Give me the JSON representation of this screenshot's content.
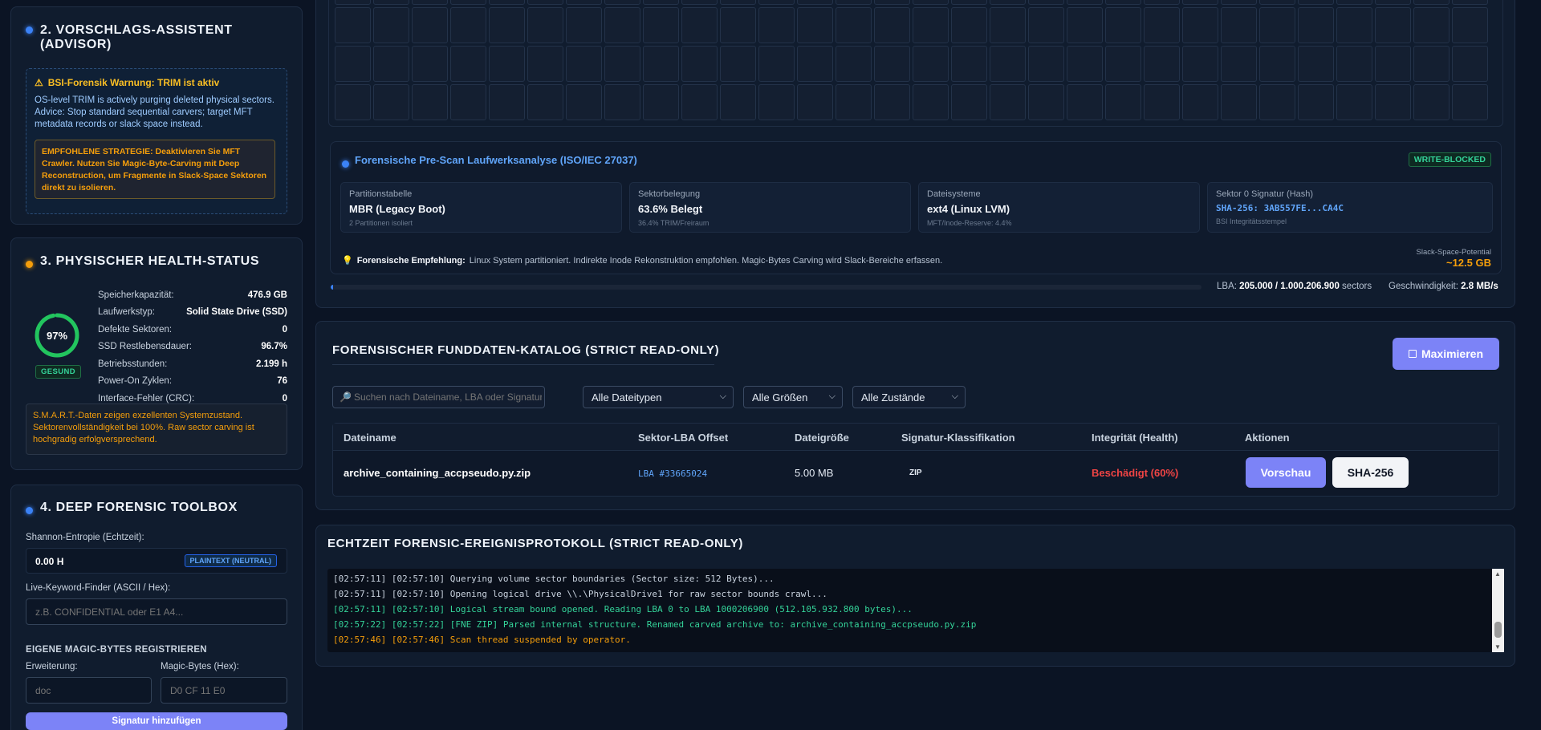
{
  "colors": {
    "background": "#0b1424",
    "panel": "#101c2e",
    "accent": "#7c83f7",
    "warning": "#f59e0b",
    "ok": "#22c55e",
    "danger": "#ef4444",
    "link": "#60a5fa"
  },
  "advisor": {
    "title": "2. VORSCHLAGS-ASSISTENT (ADVISOR)",
    "warning_title": "BSI-Forensik Warnung: TRIM ist aktiv",
    "warning_text": "OS-level TRIM is actively purging deleted physical sectors. Advice: Stop standard sequential carvers; target MFT metadata records or slack space instead.",
    "strategy_text": "EMPFOHLENE STRATEGIE: Deaktivieren Sie MFT Crawler. Nutzen Sie Magic-Byte-Carving mit Deep Reconstruction, um Fragmente in Slack-Space Sektoren direkt zu isolieren."
  },
  "health": {
    "title": "3. PHYSISCHER HEALTH-STATUS",
    "gauge_value": "97%",
    "gauge_fraction": 0.97,
    "status_badge": "GESUND",
    "rows": [
      {
        "label": "Speicherkapazität:",
        "value": "476.9 GB"
      },
      {
        "label": "Laufwerkstyp:",
        "value": "Solid State Drive (SSD)"
      },
      {
        "label": "Defekte Sektoren:",
        "value": "0"
      },
      {
        "label": "SSD Restlebensdauer:",
        "value": "96.7%"
      },
      {
        "label": "Betriebsstunden:",
        "value": "2.199 h"
      },
      {
        "label": "Power-On Zyklen:",
        "value": "76"
      },
      {
        "label": "Interface-Fehler (CRC):",
        "value": "0"
      }
    ],
    "smart_note": "S.M.A.R.T.-Daten zeigen exzellenten Systemzustand. Sektorenvollständigkeit bei 100%. Raw sector carving ist hochgradig erfolgversprechend."
  },
  "toolbox": {
    "title": "4. DEEP FORENSIC TOOLBOX",
    "entropy_label": "Shannon-Entropie (Echtzeit):",
    "entropy_value": "0.00 H",
    "entropy_badge": "PLAINTEXT (NEUTRAL)",
    "keyword_label": "Live-Keyword-Finder (ASCII / Hex):",
    "keyword_placeholder": "z.B. CONFIDENTIAL oder E1 A4...",
    "magic_title": "EIGENE MAGIC-BYTES REGISTRIEREN",
    "ext_label": "Erweiterung:",
    "ext_placeholder": "doc",
    "hex_label": "Magic-Bytes (Hex):",
    "hex_placeholder": "D0 CF 11 E0",
    "add_button": "Signatur hinzufügen"
  },
  "prescan": {
    "title": "Forensische Pre-Scan Laufwerksanalyse (ISO/IEC 27037)",
    "badge": "WRITE-BLOCKED",
    "cards": [
      {
        "label": "Partitionstabelle",
        "value": "MBR (Legacy Boot)",
        "sub": "2 Partitionen isoliert"
      },
      {
        "label": "Sektorbelegung",
        "value": "63.6% Belegt",
        "sub": "36.4% TRIM/Freiraum"
      },
      {
        "label": "Dateisysteme",
        "value": "ext4 (Linux LVM)",
        "sub": "MFT/Inode-Reserve: 4.4%"
      },
      {
        "label": "Sektor 0 Signatur (Hash)",
        "value": "SHA-256: 3AB557FE...CA4C",
        "sub": "BSI Integritätsstempel"
      }
    ],
    "recommendation_label": "Forensische Empfehlung:",
    "recommendation_text": "Linux System partitioniert. Indirekte Inode Rekonstruktion empfohlen. Magic-Bytes Carving wird Slack-Bereiche erfassen.",
    "slack_label": "Slack-Space-Potential",
    "slack_value": "~12.5 GB"
  },
  "scan_status": {
    "lba_label": "LBA:",
    "lba_value": "205.000 / 1.000.206.900",
    "lba_unit": "sectors",
    "speed_label": "Geschwindigkeit:",
    "speed_value": "2.8 MB/s",
    "progress_fraction": 0.0002
  },
  "catalog": {
    "title": "FORENSISCHER FUNDDATEN-KATALOG (STRICT READ-ONLY)",
    "maximize_button": "Maximieren",
    "search_placeholder": "Suchen nach Dateiname, LBA oder Signatur...",
    "filter_type": "Alle Dateitypen",
    "filter_size": "Alle Größen",
    "filter_state": "Alle Zustände",
    "columns": [
      "Dateiname",
      "Sektor-LBA Offset",
      "Dateigröße",
      "Signatur-Klassifikation",
      "Integrität (Health)",
      "Aktionen"
    ],
    "rows": [
      {
        "name": "archive_containing_accpseudo.py.zip",
        "lba": "LBA #33665024",
        "size": "5.00 MB",
        "sig": "ZIP",
        "health": "Beschädigt (60%)",
        "preview": "Vorschau",
        "hash": "SHA-256"
      }
    ]
  },
  "log": {
    "title": "ECHTZEIT FORENSIC-EREIGNISPROTOKOLL (STRICT READ-ONLY)",
    "lines": [
      {
        "text": "[02:57:11] [02:57:10] Querying volume sector boundaries (Sector size: 512 Bytes)...",
        "color": "#c9d3df"
      },
      {
        "text": "[02:57:11] [02:57:10] Opening logical drive \\\\.\\PhysicalDrive1 for raw sector bounds crawl...",
        "color": "#c9d3df"
      },
      {
        "text": "[02:57:11] [02:57:10] Logical stream bound opened. Reading LBA 0 to LBA 1000206900 (512.105.932.800 bytes)...",
        "color": "#34d399"
      },
      {
        "text": "[02:57:22] [02:57:22] [FNE ZIP] Parsed internal structure. Renamed carved archive to: archive_containing_accpseudo.py.zip",
        "color": "#34d399"
      },
      {
        "text": "[02:57:46] [02:57:46] Scan thread suspended by operator.",
        "color": "#f59e0b"
      }
    ]
  }
}
